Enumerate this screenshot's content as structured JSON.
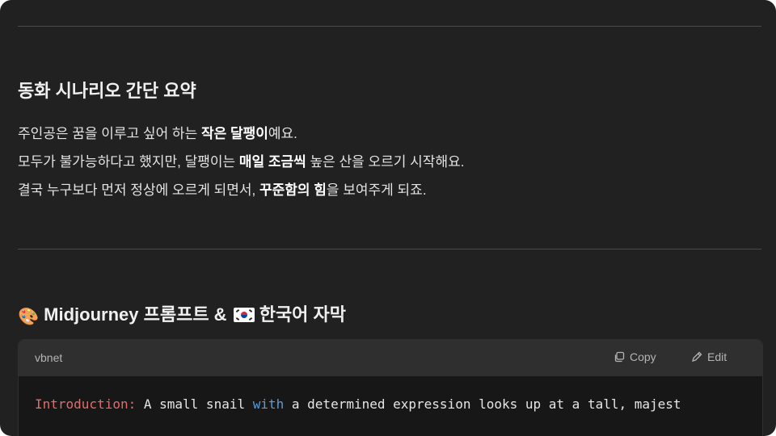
{
  "section1": {
    "title": "동화 시나리오 간단 요약",
    "line1": {
      "pre": "주인공은 꿈을 이루고 싶어 하는 ",
      "bold": "작은 달팽이",
      "post": "예요."
    },
    "line2": {
      "pre": "모두가 불가능하다고 했지만, 달팽이는 ",
      "bold": "매일 조금씩",
      "post": " 높은 산을 오르기 시작해요."
    },
    "line3": {
      "pre": "결국 누구보다 먼저 정상에 오르게 되면서, ",
      "bold": "꾸준함의 힘",
      "post": "을 보여주게 되죠."
    }
  },
  "section2": {
    "emoji": "🎨",
    "title_part1": "Midjourney 프롬프트 &",
    "title_part2": "한국어 자막",
    "flag_icon": "south-korea-flag-icon"
  },
  "code_block": {
    "language": "vbnet",
    "copy_label": "Copy",
    "edit_label": "Edit",
    "code_label": "Introduction:",
    "code_text_1": " A small snail ",
    "code_keyword": "with",
    "code_text_2": " a determined expression looks up at a tall, majest"
  },
  "colors": {
    "background": "#212121",
    "code_header": "#2f2f2f",
    "code_body": "#171717",
    "label_red": "#e06c6c",
    "keyword_blue": "#5c9bd6"
  }
}
